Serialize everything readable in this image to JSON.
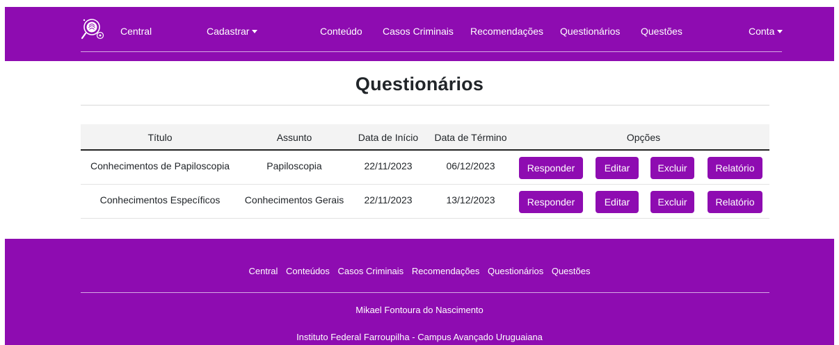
{
  "colors": {
    "primary": "#8e0cb1",
    "text": "#212529",
    "white": "#ffffff"
  },
  "navbar": {
    "brand_icon": "magnifier-fingerprint-logo-icon",
    "brand_label": "Central",
    "cadastrar_label": "Cadastrar",
    "links": [
      "Conteúdo",
      "Casos Criminais",
      "Recomendações",
      "Questionários",
      "Questões"
    ],
    "account_label": "Conta"
  },
  "page": {
    "title": "Questionários"
  },
  "table": {
    "headers": [
      "Título",
      "Assunto",
      "Data de Início",
      "Data de Término",
      "Opções"
    ],
    "rows": [
      {
        "titulo": "Conhecimentos de Papiloscopia",
        "assunto": "Papiloscopia",
        "inicio": "22/11/2023",
        "termino": "06/12/2023"
      },
      {
        "titulo": "Conhecimentos Específicos",
        "assunto": "Conhecimentos Gerais",
        "inicio": "22/11/2023",
        "termino": "13/12/2023"
      }
    ],
    "actions": {
      "respond": "Responder",
      "edit": "Editar",
      "delete": "Excluir",
      "report": "Relatório"
    }
  },
  "footer": {
    "links": [
      "Central",
      "Conteúdos",
      "Casos Criminais",
      "Recomendações",
      "Questionários",
      "Questões"
    ],
    "author": "Mikael Fontoura do Nascimento",
    "institution": "Instituto Federal Farroupilha - Campus Avançado Uruguaiana"
  }
}
